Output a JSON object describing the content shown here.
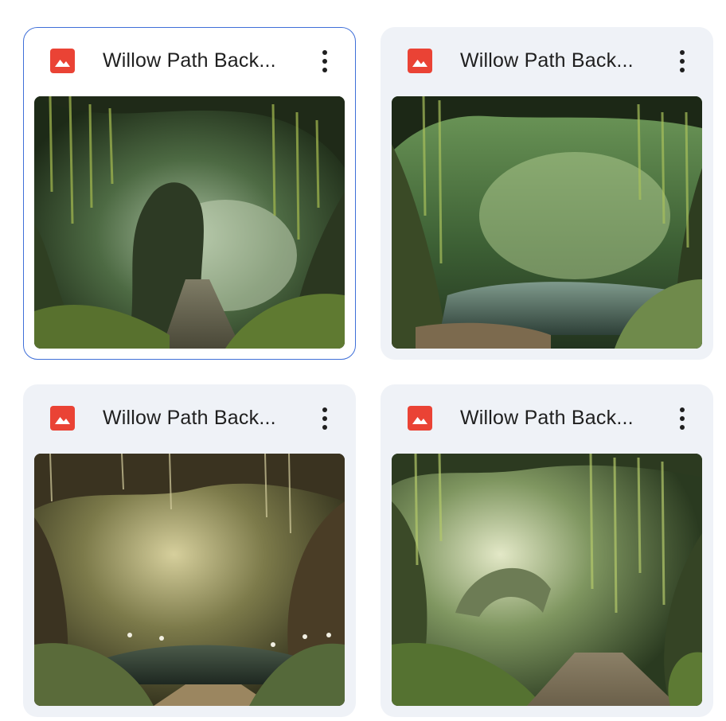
{
  "files": [
    {
      "title": "Willow Path Back...",
      "selected": true,
      "file_type_icon": "image-file-icon",
      "menu_icon": "more-vert-icon",
      "thumbnail": "willow-archway-stone-path"
    },
    {
      "title": "Willow Path Back...",
      "selected": false,
      "file_type_icon": "image-file-icon",
      "menu_icon": "more-vert-icon",
      "thumbnail": "willow-arch-over-pond"
    },
    {
      "title": "Willow Path Back...",
      "selected": false,
      "file_type_icon": "image-file-icon",
      "menu_icon": "more-vert-icon",
      "thumbnail": "golden-willow-tunnel-flowers"
    },
    {
      "title": "Willow Path Back...",
      "selected": false,
      "file_type_icon": "image-file-icon",
      "menu_icon": "more-vert-icon",
      "thumbnail": "willow-path-stone-bridge"
    }
  ],
  "colors": {
    "image_icon_red": "#ea4335",
    "selected_border": "#3f6fd8",
    "card_background": "#eff2f7",
    "title_text": "#1f1f1f"
  }
}
